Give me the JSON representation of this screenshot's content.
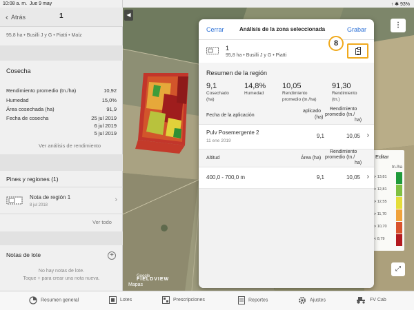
{
  "status": {
    "time": "10:08 a. m.",
    "date": "Jue 9 may",
    "right": "↑ ✱ 93%"
  },
  "nav": {
    "back_label": "Atrás",
    "title": "1"
  },
  "field": {
    "info": "95,8 ha • Busilli J y G • Piatti • Maíz"
  },
  "harvest": {
    "title": "Cosecha",
    "rows": [
      {
        "label": "Rendimiento promedio (tn./ha)",
        "value": "10,92"
      },
      {
        "label": "Humedad",
        "value": "15,0%"
      },
      {
        "label": "Área cosechada (ha)",
        "value": "91,9"
      },
      {
        "label": "Fecha de cosecha",
        "value": "25 jul 2019"
      }
    ],
    "extra_dates": [
      "6 jul 2019",
      "5 jul 2019"
    ],
    "link": "Ver análisis de rendimiento"
  },
  "pins": {
    "title": "Pines y regiones (1)",
    "note_title": "Nota de región 1",
    "note_date": "8 jul 2018",
    "view_all": "Ver todo"
  },
  "lot_notes": {
    "title": "Notas de lote",
    "plus": "+",
    "empty_line1": "No hay notas de lote.",
    "empty_line2": "Toque + para crear una nota nueva."
  },
  "map": {
    "collapse": "◀",
    "more": "⋮",
    "expand": "⤢",
    "google": "Google",
    "fieldview": "FIELDVIEW",
    "mapas": "Mapas"
  },
  "legend": {
    "header": "Editar",
    "unit": "tn./ha",
    "rows": [
      {
        "label": "> 13,81",
        "color": "#1f9a3a"
      },
      {
        "label": "> 12,81",
        "color": "#7fc042"
      },
      {
        "label": "> 12,55",
        "color": "#e4dd3a"
      },
      {
        "label": "> 11,70",
        "color": "#f0a23b"
      },
      {
        "label": "> 10,70",
        "color": "#d9532d"
      },
      {
        "label": "< 8,79",
        "color": "#b3191f"
      }
    ]
  },
  "modal": {
    "cancel": "Cerrar",
    "title": "Análisis de la zona seleccionada",
    "save": "Grabar",
    "field_number": "1",
    "field_info": "95,8 ha • Busilli J y G • Piatti",
    "callout_number": "8",
    "summary_title": "Resumen de la región",
    "stats": [
      {
        "value": "9,1",
        "label1": "Cosechado",
        "label2": "(ha)"
      },
      {
        "value": "14,8%",
        "label1": "Humedad",
        "label2": ""
      },
      {
        "value": "10,05",
        "label1": "Rendimiento",
        "label2": "promedio (tn./ha)"
      },
      {
        "value": "91,30",
        "label1": "Rendimiento",
        "label2": "(tn.)"
      }
    ],
    "app_table": {
      "col1": "Fecha de la aplicación",
      "col2a": "aplicado",
      "col2b": "(ha)",
      "col3a": "Rendimiento",
      "col3b": "promedio (tn./",
      "col3c": "ha)",
      "row": {
        "name": "Pulv Posemergente 2",
        "date": "11 ene 2019",
        "area": "9,1",
        "yield": "10,05"
      }
    },
    "alt_table": {
      "col1": "Altitud",
      "col2": "Área (ha)",
      "col3a": "Rendimiento",
      "col3b": "promedio (tn./",
      "col3c": "ha)",
      "row": {
        "name": "400,0 - 700,0 m",
        "area": "9,1",
        "yield": "10,05"
      }
    },
    "chevron": "›"
  },
  "tabs": [
    {
      "label": "Resumen general",
      "icon": "overview-icon"
    },
    {
      "label": "Lotes",
      "icon": "fields-icon"
    },
    {
      "label": "Prescripciones",
      "icon": "prescriptions-icon"
    },
    {
      "label": "Reportes",
      "icon": "reports-icon"
    },
    {
      "label": "Ajustes",
      "icon": "settings-gear-icon"
    },
    {
      "label": "FV Cab",
      "icon": "tractor-icon"
    }
  ]
}
